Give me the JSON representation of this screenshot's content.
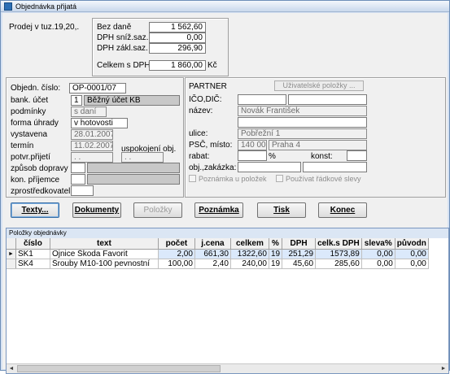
{
  "window": {
    "title": "Objednávka přijatá"
  },
  "summary": {
    "sale_label": "Prodej v tuz.19,20,.",
    "bez_dane_label": "Bez daně",
    "bez_dane_value": "1 562,60",
    "dph_sniz_label": "DPH sníž.saz.",
    "dph_sniz_value": "0,00",
    "dph_zakl_label": "DPH zákl.saz.",
    "dph_zakl_value": "296,90",
    "celkem_label": "Celkem s DPH",
    "celkem_value": "1 860,00",
    "currency": "Kč"
  },
  "order": {
    "cislo_label": "Objedn. číslo:",
    "cislo_value": "OP-0001/07",
    "bank_label": "bank. účet",
    "bank_num": "1",
    "bank_name": "Běžný účet KB",
    "podminky_label": "podmínky",
    "podminky_value": "s daní",
    "forma_label": "forma úhrady",
    "forma_value": "v hotovosti",
    "vystavena_label": "vystavena",
    "vystavena_value": "28.01.2007",
    "termin_label": "termín",
    "termin_value": "11.02.2007",
    "uspokojeni_label": "uspokojení obj.",
    "uspokojeni_value": ". .",
    "potvr_label": "potvr.přijetí",
    "potvr_value": ". .",
    "zpusob_label": "způsob dopravy",
    "prijemce_label": "kon. příjemce",
    "zprostredkovatel_label": "zprostředkovatel"
  },
  "partner": {
    "heading": "PARTNER",
    "user_items_button": "Uživatelské položky ...",
    "ico_label": "IČO,DIČ:",
    "nazev_label": "název:",
    "nazev_value": "Novák František",
    "ulice_label": "ulice:",
    "ulice_value": "Pobřežní 1",
    "psc_label": "PSČ, místo:",
    "psc_value": "140 00",
    "misto_value": "Praha 4",
    "rabat_label": "rabat:",
    "rabat_unit": "%",
    "konst_label": "konst:",
    "zakazka_label": "obj.,zakázka:",
    "poznamka_check": "Poznámka u položek",
    "slevy_check": "Používat řádkové slevy"
  },
  "buttons": {
    "texty": "Texty...",
    "dokumenty": "Dokumenty",
    "polozky": "Položky",
    "poznamka": "Poznámka",
    "tisk": "Tisk",
    "konec": "Konec"
  },
  "grid": {
    "title": "Položky objednávky",
    "columns": [
      "číslo",
      "text",
      "počet",
      "j.cena",
      "celkem",
      "%",
      "DPH",
      "celk.s DPH",
      "sleva%",
      "původn"
    ],
    "rows": [
      [
        "SK1",
        "Ojnice Škoda Favorit",
        "2,00",
        "661,30",
        "1322,60",
        "19",
        "251,29",
        "1573,89",
        "0,00",
        "0,00"
      ],
      [
        "SK4",
        "Šrouby M10-100 pevnostní",
        "100,00",
        "2,40",
        "240,00",
        "19",
        "45,60",
        "285,60",
        "0,00",
        "0,00"
      ]
    ]
  }
}
